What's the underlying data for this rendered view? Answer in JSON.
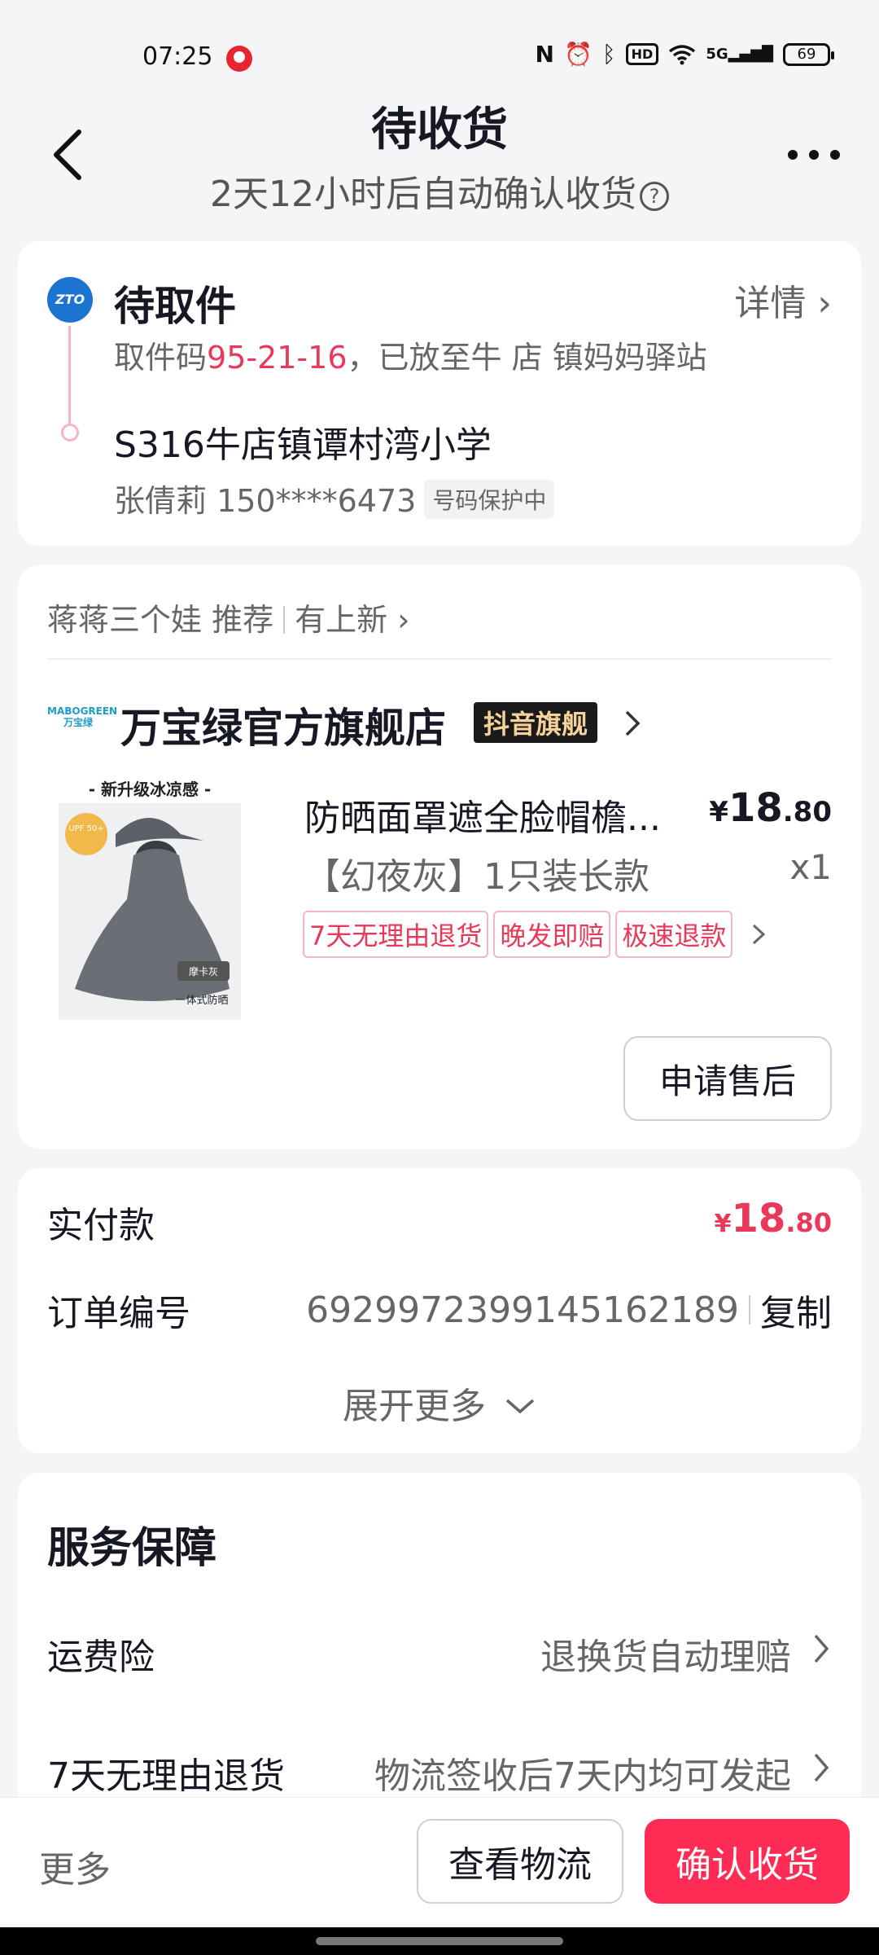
{
  "status_bar": {
    "time": "07:25",
    "network": "5G",
    "hd": "HD",
    "battery": "69",
    "icons": [
      "nfc-icon",
      "alarm-icon",
      "bluetooth-icon",
      "hd-icon",
      "wifi-icon",
      "signal-icon",
      "battery-icon"
    ]
  },
  "header": {
    "title": "待收货",
    "subtitle": "2天12小时后自动确认收货",
    "help": "?"
  },
  "delivery": {
    "carrier_logo": "ZTO",
    "status": "待取件",
    "detail_link": "详情",
    "pickup_prefix": "取件码",
    "pickup_code": "95-21-16",
    "pickup_suffix": "，已放至牛 店 镇妈妈驿站",
    "address": "S316牛店镇谭村湾小学",
    "contact": "张倩莉 150****6473",
    "privacy_tag": "号码保护中"
  },
  "recommend": {
    "label": "蒋蒋三个娃 推荐",
    "new_link": "有上新"
  },
  "store": {
    "logo_text": "MABOGREEN 万宝绿",
    "name": "万宝绿官方旗舰店",
    "badge": "抖音旗舰"
  },
  "product": {
    "image_caption_top": "- 新升级冰凉感 -",
    "image_upf": "UPF 50+",
    "image_color": "摩卡灰",
    "image_caption_bottom": "一体式防晒",
    "title": "防晒面罩遮全脸帽檐...",
    "price_symbol": "¥",
    "price_int": "18",
    "price_dec": ".80",
    "spec": "【幻夜灰】1只装长款",
    "qty": "x1",
    "tags": [
      "7天无理由退货",
      "晚发即赔",
      "极速退款"
    ],
    "after_sale_button": "申请售后"
  },
  "payment": {
    "paid_label": "实付款",
    "paid_symbol": "¥",
    "paid_int": "18",
    "paid_dec": ".80",
    "order_label": "订单编号",
    "order_no": "6929972399145162189",
    "copy": "复制",
    "expand": "展开更多"
  },
  "service": {
    "title": "服务保障",
    "rows": [
      {
        "label": "运费险",
        "value": "退换货自动理赔"
      },
      {
        "label": "7天无理由退货",
        "value": "物流签收后7天内均可发起"
      }
    ]
  },
  "bottom_bar": {
    "more": "更多",
    "logistics": "查看物流",
    "confirm": "确认收货"
  },
  "colors": {
    "accent": "#fe2c55",
    "price_pink": "#e8395a",
    "background": "#f5f5f7"
  }
}
